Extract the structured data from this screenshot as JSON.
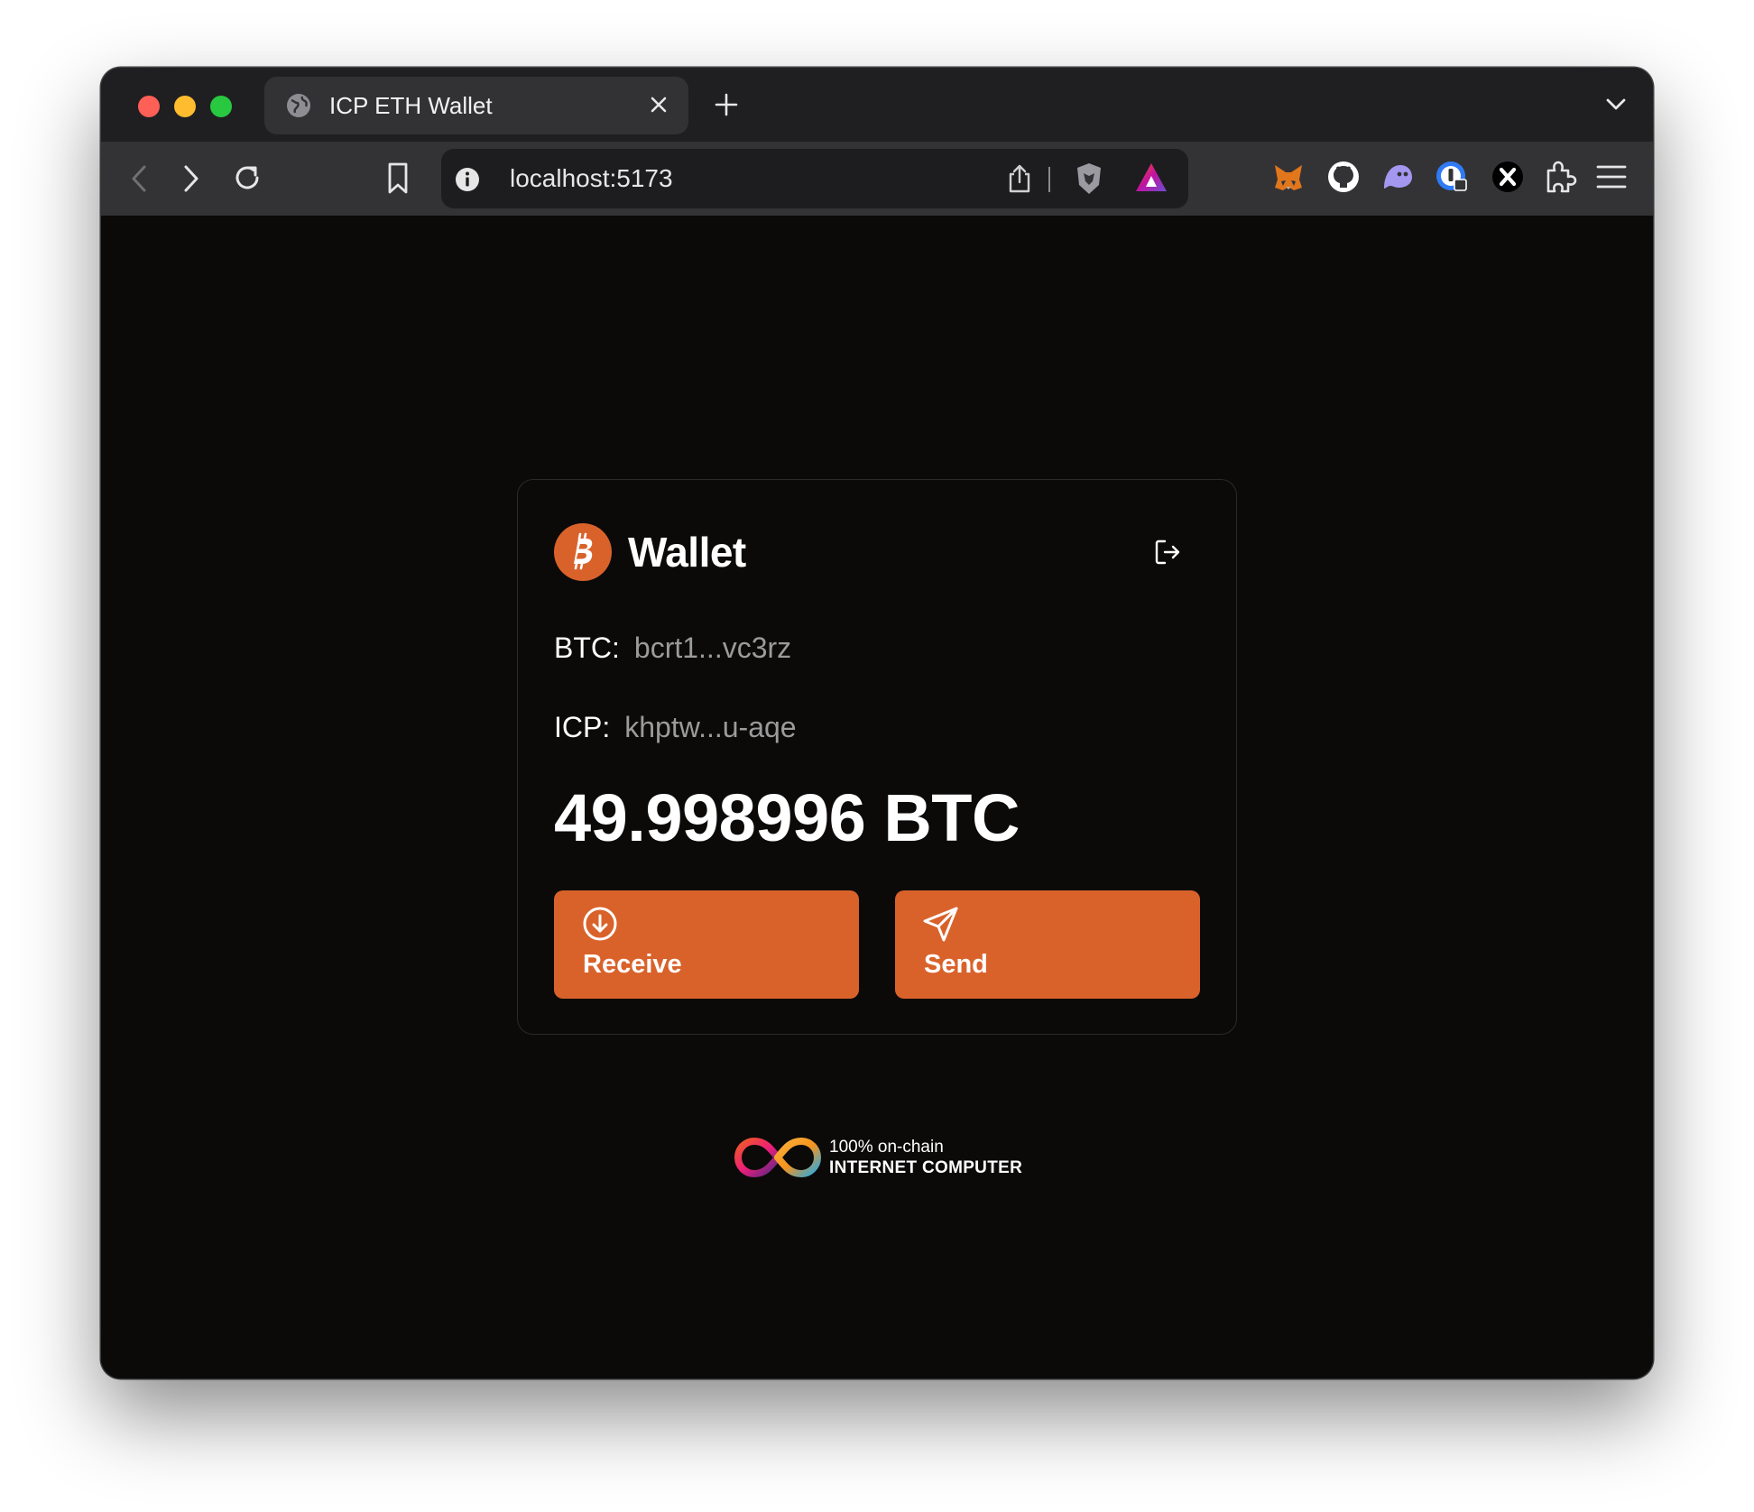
{
  "browser": {
    "tab_title": "ICP ETH Wallet",
    "url": "localhost:5173"
  },
  "icons": {
    "tab": [
      "globe-icon",
      "close-icon",
      "plus-icon",
      "chevron-down-icon"
    ],
    "toolbar": [
      "back-icon",
      "forward-icon",
      "reload-icon",
      "bookmark-icon",
      "info-icon",
      "share-icon",
      "brave-shield-icon",
      "brave-rewards-icon",
      "metamask-icon",
      "github-icon",
      "ghost-extension-icon",
      "password-manager-icon",
      "x-extension-icon",
      "puzzle-icon",
      "menu-icon"
    ],
    "wallet": [
      "bitcoin-icon",
      "logout-icon",
      "arrow-down-circle-icon",
      "send-icon",
      "infinity-icon"
    ]
  },
  "wallet": {
    "title": "Wallet",
    "btc_label": "BTC:",
    "btc_address": "bcrt1...vc3rz",
    "icp_label": "ICP:",
    "icp_address": "khptw...u-aqe",
    "balance": "49.998996 BTC",
    "receive_label": "Receive",
    "send_label": "Send"
  },
  "footer": {
    "line1": "100% on-chain",
    "line2": "INTERNET COMPUTER"
  },
  "colors": {
    "accent": "#d9622b",
    "page_bg": "#0b0a09",
    "muted_text": "#9b9b9b"
  }
}
